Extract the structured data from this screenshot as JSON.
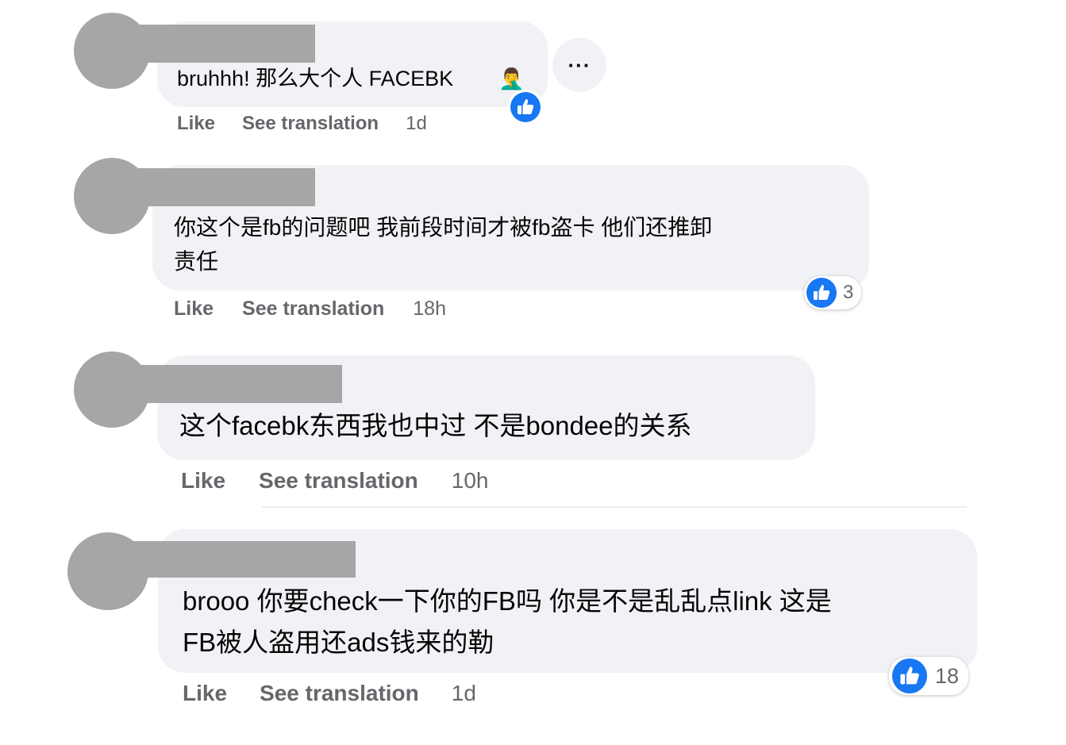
{
  "comments": [
    {
      "text": "bruhhh! 那么大个人 FACEBK",
      "emoji": "🤦‍♂️",
      "actions": {
        "like": "Like",
        "translate": "See translation",
        "time": "1d"
      },
      "more_label": "···"
    },
    {
      "text": "你这个是fb的问题吧 我前段时间才被fb盗卡 他们还推卸\n责任",
      "actions": {
        "like": "Like",
        "translate": "See translation",
        "time": "18h"
      },
      "reaction_count": "3"
    },
    {
      "text": "这个facebk东西我也中过 不是bondee的关系",
      "actions": {
        "like": "Like",
        "translate": "See translation",
        "time": "10h"
      }
    },
    {
      "text": "brooo 你要check一下你的FB吗 你是不是乱乱点link 这是\nFB被人盗用还ads钱来的勒",
      "actions": {
        "like": "Like",
        "translate": "See translation",
        "time": "1d"
      },
      "reaction_count": "18"
    }
  ],
  "colors": {
    "like_blue": "#1877f2",
    "bubble": "#f0f2f5",
    "meta": "#65676b",
    "redaction": "#a6a6a6"
  },
  "icons": {
    "like": "thumbs-up-icon",
    "more": "more-dots-icon"
  }
}
